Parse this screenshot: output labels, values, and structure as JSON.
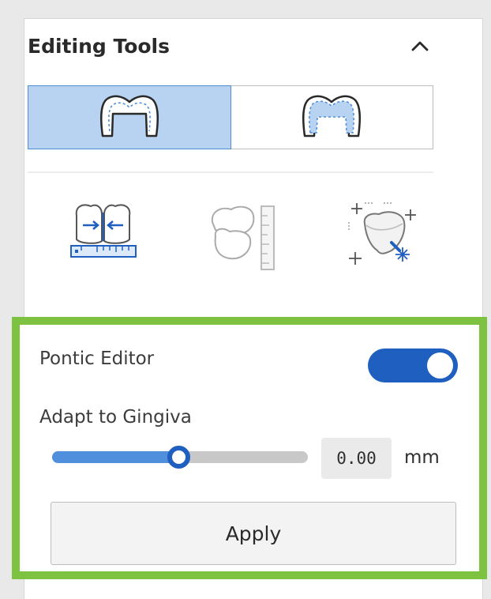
{
  "panel": {
    "title": "Editing Tools",
    "collapse_icon": "chevron-up-icon"
  },
  "segment": {
    "options": [
      {
        "icon": "crown-outline-icon",
        "selected": true
      },
      {
        "icon": "crown-inner-icon",
        "selected": false
      }
    ]
  },
  "tools": [
    {
      "icon": "tooth-gap-measure-icon"
    },
    {
      "icon": "tooth-ruler-icon"
    },
    {
      "icon": "tooth-magic-wand-icon"
    }
  ],
  "pontic": {
    "label": "Pontic Editor",
    "enabled": true,
    "adapt_label": "Adapt to Gingiva",
    "slider_fraction": 0.5,
    "value": "0.00",
    "unit": "mm",
    "apply_label": "Apply"
  },
  "colors": {
    "accent": "#1f5fbf",
    "selection_bg": "#b8d3f2",
    "highlight_border": "#7dc241"
  }
}
